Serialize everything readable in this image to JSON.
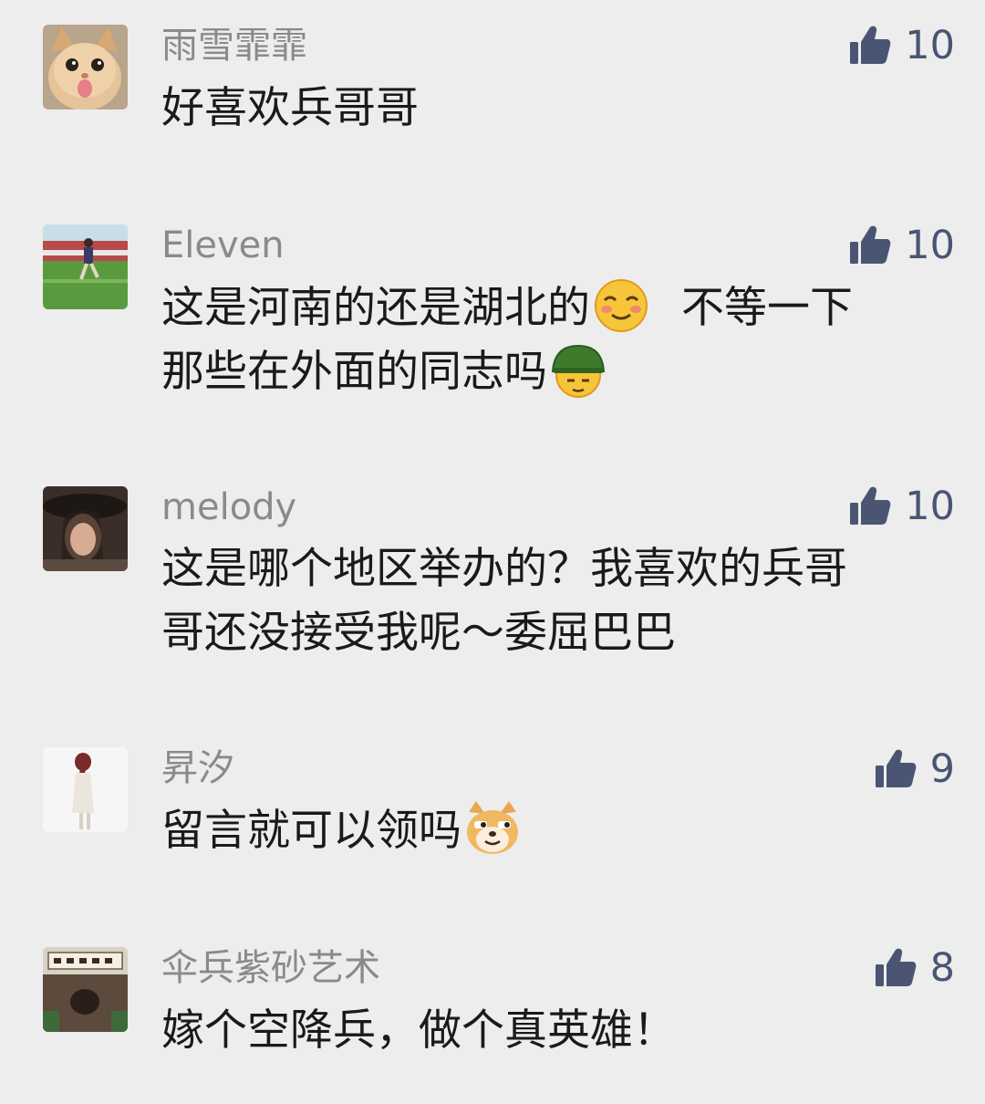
{
  "comments": [
    {
      "username": "雨雪霏霏",
      "likes": "10",
      "text": "好喜欢兵哥哥",
      "avatar_icon": "cat-avatar-icon"
    },
    {
      "username": "Eleven",
      "likes": "10",
      "text_line1_a": "这是河南的还是湖北的",
      "text_line1_b": "不等一下",
      "text_line2": "那些在外面的同志吗",
      "avatar_icon": "soccer-field-avatar-icon",
      "emojis": [
        "blush-smile-emoji-icon",
        "army-helmet-emoji-icon"
      ]
    },
    {
      "username": "melody",
      "likes": "10",
      "text_line1": "这是哪个地区举办的？我喜欢的兵哥",
      "text_line2": "哥还没接受我呢～委屈巴巴",
      "avatar_icon": "woman-hat-avatar-icon"
    },
    {
      "username": "昇汐",
      "likes": "9",
      "text": "留言就可以领吗",
      "avatar_icon": "braided-girl-avatar-icon",
      "emojis": [
        "doge-emoji-icon"
      ]
    },
    {
      "username": "伞兵紫砂艺术",
      "likes": "8",
      "text": "嫁个空降兵，做个真英雄！",
      "avatar_icon": "teapot-shop-avatar-icon"
    }
  ],
  "colors": {
    "background": "#ededed",
    "username": "#8a8a8a",
    "text": "#1a1a1a",
    "like": "#4a5574"
  }
}
